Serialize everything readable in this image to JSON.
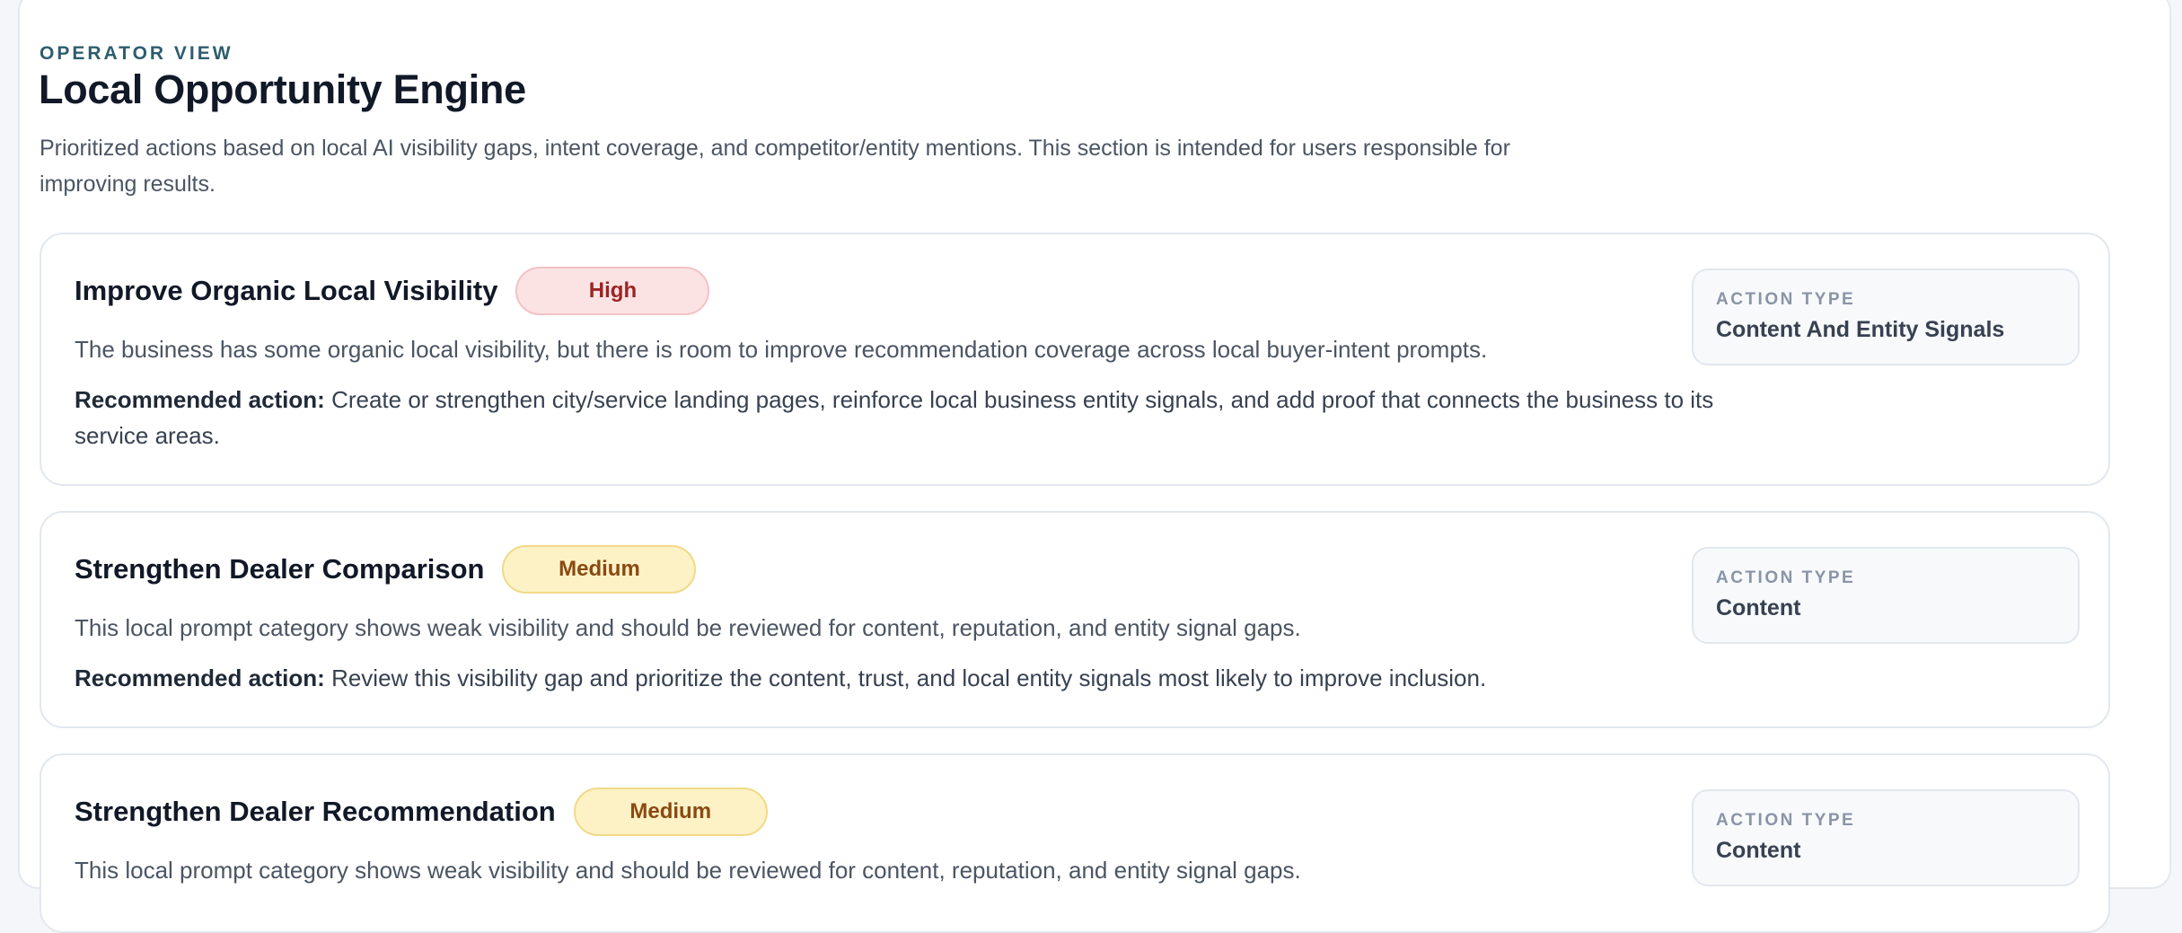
{
  "header": {
    "eyebrow": "OPERATOR VIEW",
    "title": "Local Opportunity Engine",
    "description": "Prioritized actions based on local AI visibility gaps, intent coverage, and competitor/entity mentions. This section is intended for users responsible for improving results."
  },
  "opportunities": [
    {
      "title": "Improve Organic Local Visibility",
      "priority": "High",
      "description": "The business has some organic local visibility, but there is room to improve recommendation coverage across local buyer-intent prompts.",
      "recommended_label": "Recommended action:",
      "recommended_text": "Create or strengthen city/service landing pages, reinforce local business entity signals, and add proof that connects the business to its service areas.",
      "action_type_label": "ACTION TYPE",
      "action_type": "Content And Entity Signals"
    },
    {
      "title": "Strengthen Dealer Comparison",
      "priority": "Medium",
      "description": "This local prompt category shows weak visibility and should be reviewed for content, reputation, and entity signal gaps.",
      "recommended_label": "Recommended action:",
      "recommended_text": "Review this visibility gap and prioritize the content, trust, and local entity signals most likely to improve inclusion.",
      "action_type_label": "ACTION TYPE",
      "action_type": "Content"
    },
    {
      "title": "Strengthen Dealer Recommendation",
      "priority": "Medium",
      "description": "This local prompt category shows weak visibility and should be reviewed for content, reputation, and entity signal gaps.",
      "action_type_label": "ACTION TYPE",
      "action_type": "Content"
    }
  ],
  "colors": {
    "eyebrow": "#2e5d6e",
    "high_badge_bg": "#fbe3e4",
    "high_badge_text": "#9b2424",
    "medium_badge_bg": "#fdf2c6",
    "medium_badge_text": "#8a4a12"
  }
}
